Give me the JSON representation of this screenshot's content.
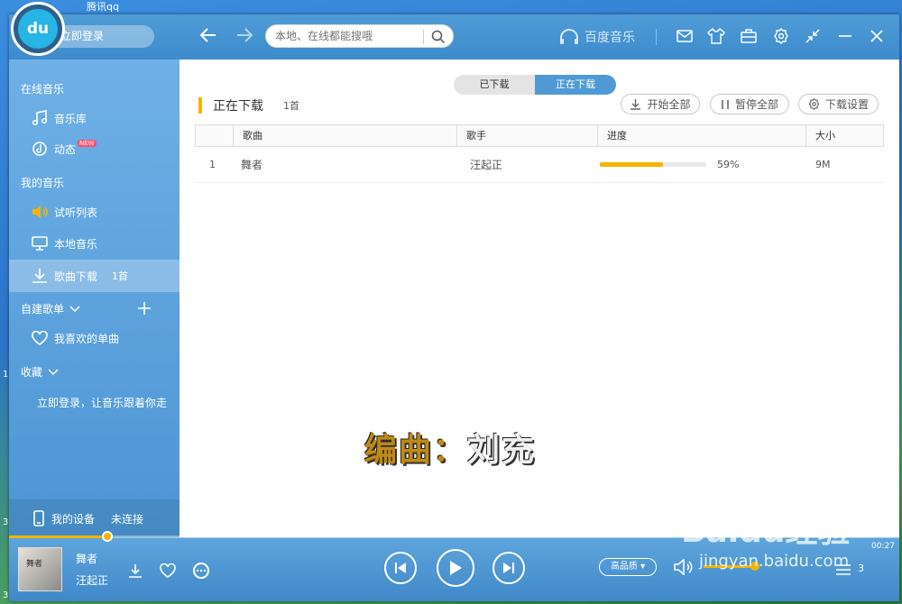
{
  "desktop": {
    "taskbar_items": [
      "腾讯qq"
    ],
    "edge_numbers": [
      "1",
      "3",
      "3"
    ]
  },
  "topbar": {
    "login_label": "立即登录",
    "search_placeholder": "本地、在线都能搜哦",
    "brand": "百度音乐",
    "icons": [
      "back-arrow-icon",
      "forward-arrow-icon",
      "search-icon",
      "mail-icon",
      "skin-icon",
      "toolbox-icon",
      "settings-icon",
      "minimize-mode-icon",
      "minimize-icon",
      "close-icon"
    ]
  },
  "sidebar": {
    "online_header": "在线音乐",
    "music_library": "音乐库",
    "dynamics": "动态",
    "dynamics_badge": "NEW",
    "my_music_header": "我的音乐",
    "trial_list": "试听列表",
    "local_music": "本地音乐",
    "downloads": "歌曲下载",
    "downloads_count": "1首",
    "playlists_header": "自建歌单",
    "favorites": "我喜欢的单曲",
    "collections_header": "收藏",
    "login_prompt": "立即登录，让音乐跟着你走",
    "device_label": "我的设备",
    "device_status": "未连接"
  },
  "main": {
    "tabs": [
      {
        "label": "已下载",
        "active": false
      },
      {
        "label": "正在下载",
        "active": true
      }
    ],
    "title": "正在下载",
    "title_count": "1首",
    "actions": {
      "start_all": "开始全部",
      "pause_all": "暂停全部",
      "settings": "下载设置"
    },
    "columns": [
      "",
      "歌曲",
      "歌手",
      "进度",
      "大小"
    ],
    "rows": [
      {
        "index": "1",
        "song": "舞者",
        "artist": "汪起正",
        "progress": 59,
        "progress_label": "59%",
        "size": "9M"
      }
    ],
    "subtitle_a": "编曲：",
    "subtitle_b": "刘充"
  },
  "player": {
    "song": "舞者",
    "artist": "汪起正",
    "album_text": "舞者",
    "quality": "高品质",
    "time": "00:27",
    "seek_progress": 11,
    "volume": 95,
    "queue_count": "3",
    "watermark": "Baidu经验",
    "watermark_url": "jingyan.baidu.com"
  },
  "colors": {
    "accent": "#f4b400",
    "topbar": "#4f9cd6",
    "tab_active": "#4f9ad4"
  }
}
